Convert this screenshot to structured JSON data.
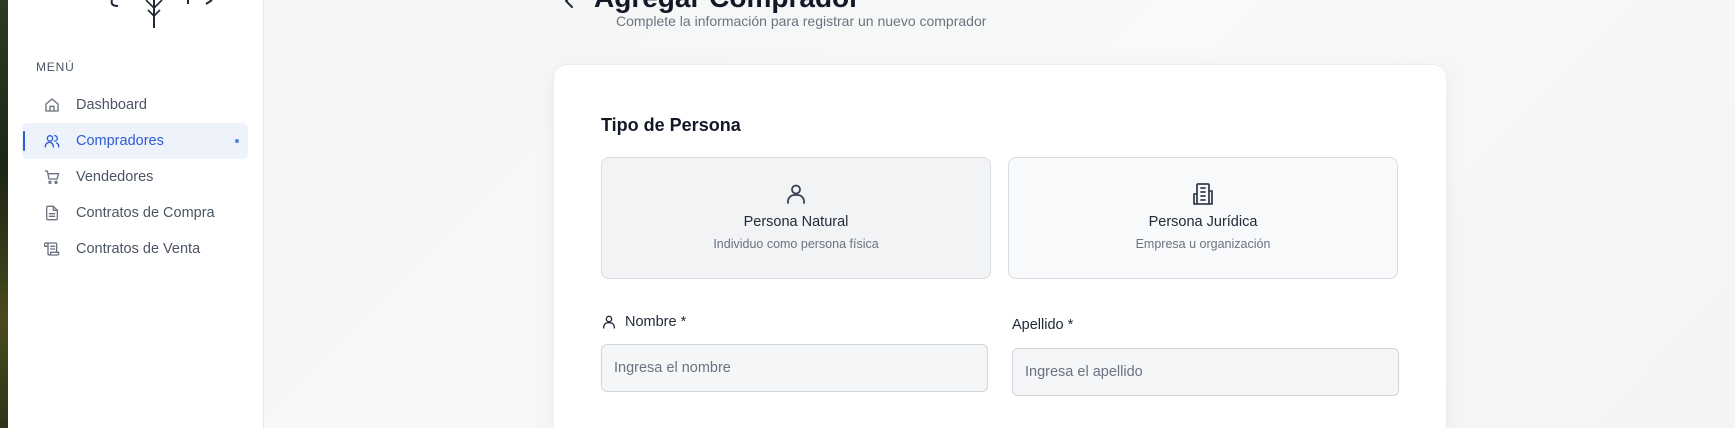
{
  "sidebar": {
    "menu_heading": "MENÚ",
    "items": [
      {
        "label": "Dashboard",
        "icon": "home-icon"
      },
      {
        "label": "Compradores",
        "icon": "users-icon"
      },
      {
        "label": "Vendedores",
        "icon": "cart-icon"
      },
      {
        "label": "Contratos de Compra",
        "icon": "file-text-icon"
      },
      {
        "label": "Contratos de Venta",
        "icon": "scroll-icon"
      }
    ],
    "active_index": 1
  },
  "header": {
    "title": "Agregar Comprador",
    "subtitle": "Complete la información para registrar un nuevo comprador"
  },
  "form": {
    "section_title": "Tipo de Persona",
    "person_types": [
      {
        "title": "Persona Natural",
        "description": "Individuo como persona física",
        "icon": "user-icon",
        "selected": true
      },
      {
        "title": "Persona Jurídica",
        "description": "Empresa u organización",
        "icon": "building-icon",
        "selected": false
      }
    ],
    "fields": {
      "nombre": {
        "label": "Nombre *",
        "placeholder": "Ingresa el nombre",
        "value": ""
      },
      "apellido": {
        "label": "Apellido *",
        "placeholder": "Ingresa el apellido",
        "value": ""
      }
    }
  },
  "colors": {
    "accent": "#2d5bd3",
    "active_bg": "#eef2fb"
  }
}
